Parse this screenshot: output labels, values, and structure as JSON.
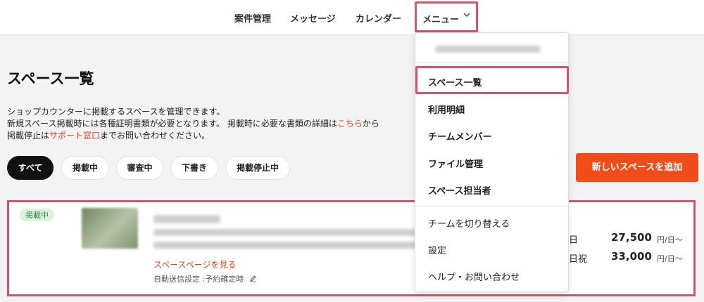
{
  "nav": {
    "items": [
      "案件管理",
      "メッセージ",
      "カレンダー"
    ],
    "menu_label": "メニュー",
    "menu_chevron": "chevron-down-icon"
  },
  "page": {
    "title": "スペース一覧",
    "desc_line1": "ショップカウンターに掲載するスペースを管理できます。",
    "desc_line2_a": "新規スペース掲載時には各種証明書類が必要となります。 掲載時に必要な書類の詳細は",
    "desc_line2_link": "こちら",
    "desc_line2_b": "から",
    "desc_line3_a": "掲載停止は",
    "desc_line3_link": "サポート窓口",
    "desc_line3_b": "までお問い合わせください。"
  },
  "filters": [
    "すべて",
    "掲載中",
    "審査中",
    "下書き",
    "掲載停止中"
  ],
  "add_button": "新しいスペースを追加",
  "card": {
    "badge": "掲載中",
    "link": "スペースページを見る",
    "meta": "自動送信設定 :予約確定時",
    "meta_icon": "pencil-icon",
    "prices": [
      {
        "label": "日",
        "value": "27,500",
        "unit": "円/日〜"
      },
      {
        "label": "日祝",
        "value": "33,000",
        "unit": "円/日〜"
      }
    ]
  },
  "dropdown": {
    "items": [
      "スペース一覧",
      "利用明細",
      "チームメンバー",
      "ファイル管理",
      "スペース担当者"
    ],
    "secondary": [
      "チームを切り替える",
      "設定",
      "ヘルプ・お問い合わせ"
    ]
  },
  "colors": {
    "accent": "#f04d1a",
    "highlight": "#d2556a",
    "badge_bg": "#dff1df"
  }
}
